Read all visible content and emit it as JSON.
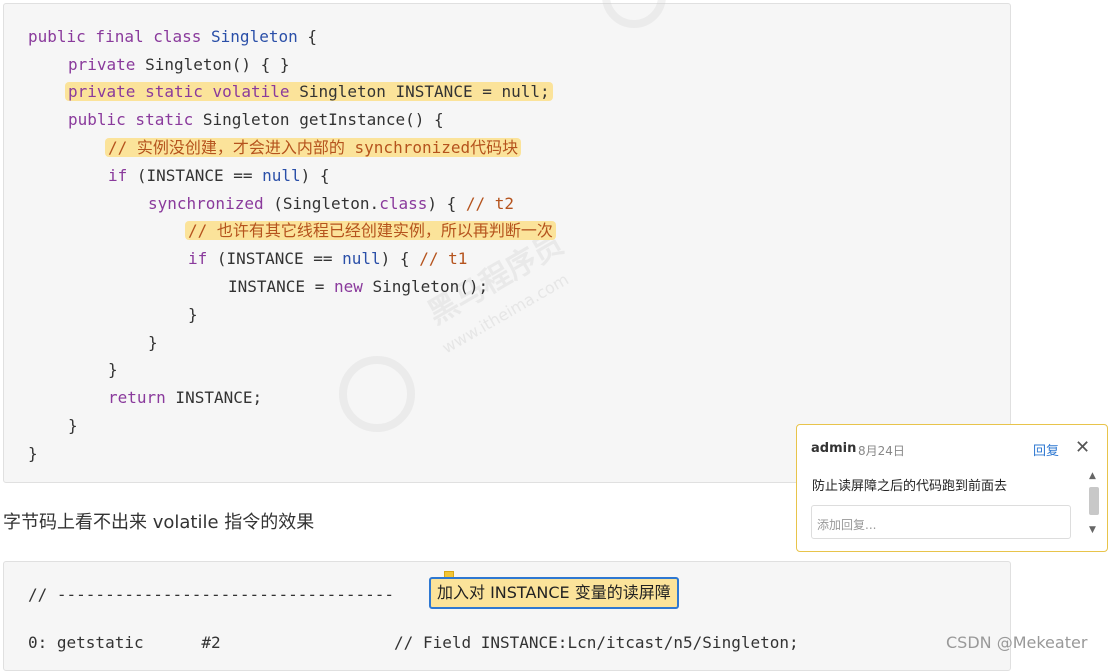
{
  "code": {
    "l1": {
      "kw": "public final class ",
      "ty": "Singleton",
      "rest": " {"
    },
    "l2": {
      "kw": "private ",
      "rest": "Singleton() { }"
    },
    "l3": {
      "text": "private static volatile Singleton INSTANCE = null;"
    },
    "l4": {
      "kw": "public static ",
      "rest": "Singleton getInstance() {"
    },
    "l5": {
      "comment": "// 实例没创建，才会进入内部的 synchronized代码块"
    },
    "l6": {
      "kw": "if",
      "mid": " (INSTANCE == ",
      "nul": "null",
      "rest": ") {"
    },
    "l7": {
      "kw": "synchronized",
      "mid": " (Singleton.",
      "kw2": "class",
      "rest": ") { ",
      "comment": "// t2"
    },
    "l8": {
      "comment": "// 也许有其它线程已经创建实例，所以再判断一次"
    },
    "l9": {
      "kw": "if",
      "mid": " (INSTANCE == ",
      "nul": "null",
      "rest": ") { ",
      "comment": "// t1"
    },
    "l10": {
      "mid": "INSTANCE = ",
      "kw": "new",
      "rest": " Singleton();"
    },
    "l11": "}",
    "l12": "}",
    "l13": "}",
    "l14": {
      "kw": "return",
      "rest": " INSTANCE;"
    },
    "l15": "}",
    "l16": "}"
  },
  "watermark": {
    "text": "黑马程序员",
    "url": "www.itheima.com"
  },
  "paragraph": "字节码上看不出来 volatile 指令的效果",
  "code2": {
    "line1": "// -----------------------------------",
    "annotation": "加入对 INSTANCE 变量的读屏障",
    "line2": "0: getstatic      #2                  // Field INSTANCE:Lcn/itcast/n5/Singleton;"
  },
  "popup": {
    "author": "admin",
    "date": "8月24日",
    "reply_label": "回复",
    "close_symbol": "✕",
    "comment": "防止读屏障之后的代码跑到前面去",
    "reply_placeholder": "添加回复..."
  },
  "footer": "CSDN @Mekeater",
  "colors": {
    "highlight": "#fbe39a",
    "keyword": "#8a3a9c",
    "type": "#2a4fa8",
    "comment": "#b5531d",
    "link": "#2e78d2"
  }
}
